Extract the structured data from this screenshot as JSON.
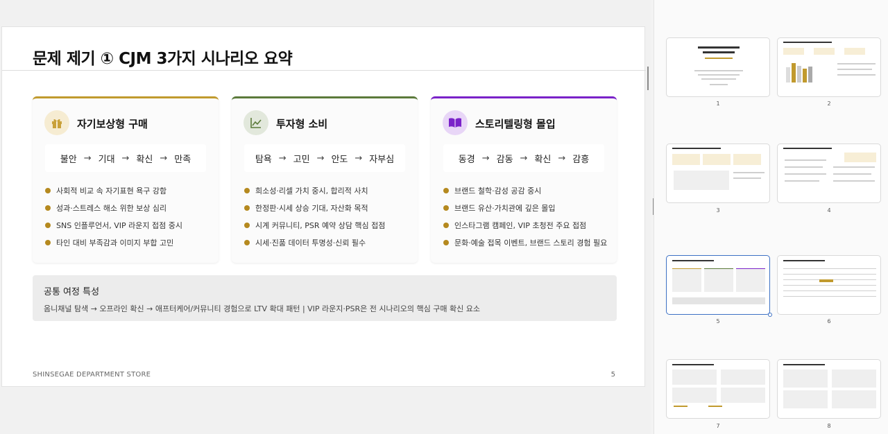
{
  "slide": {
    "title": "문제 제기 ① CJM 3가지 시나리오 요약",
    "cards": [
      {
        "title": "자기보상형 구매",
        "icon": "gift-icon",
        "accent": "#c19a2e",
        "flow": [
          "불안",
          "기대",
          "확신",
          "만족"
        ],
        "bullets": [
          "사회적 비교 속 자기표현 욕구 강함",
          "성과·스트레스 해소 위한 보상 심리",
          "SNS 인플루언서, VIP 라운지 접점 중시",
          "타인 대비 부족감과 이미지 부합 고민"
        ]
      },
      {
        "title": "투자형 소비",
        "icon": "chart-line-icon",
        "accent": "#5b7a3a",
        "flow": [
          "탐욕",
          "고민",
          "안도",
          "자부심"
        ],
        "bullets": [
          "희소성·리셀 가치 중시, 합리적 사치",
          "한정판·시세 상승 기대, 자산화 목적",
          "시계 커뮤니티, PSR 예약 상담 핵심 접점",
          "시세·진품 데이터 투명성·신뢰 필수"
        ]
      },
      {
        "title": "스토리텔링형 몰입",
        "icon": "book-icon",
        "accent": "#7a22c9",
        "flow": [
          "동경",
          "감동",
          "확신",
          "감흥"
        ],
        "bullets": [
          "브랜드 철학·감성 공감 중시",
          "브랜드 유산·가치관에 깊은 몰입",
          "인스타그램 캠페인, VIP 초청전 주요 접점",
          "문화·예술 접목 이벤트, 브랜드 스토리 경험 필요"
        ]
      }
    ],
    "flow_arrow": "→",
    "common": {
      "title": "공통 여정 특성",
      "body": "옴니채널 탐색 → 오프라인 확신 → 애프터케어/커뮤니티 경험으로 LTV 확대 패턴 | VIP 라운지·PSR은 전 시나리오의 핵심 구매 확신 요소"
    },
    "footer": {
      "brand": "SHINSEGAE DEPARTMENT STORE",
      "page": "5"
    }
  },
  "thumbnails": [
    {
      "num": "1"
    },
    {
      "num": "2"
    },
    {
      "num": "3"
    },
    {
      "num": "4"
    },
    {
      "num": "5",
      "selected": true
    },
    {
      "num": "6"
    },
    {
      "num": "7"
    },
    {
      "num": "8"
    }
  ]
}
